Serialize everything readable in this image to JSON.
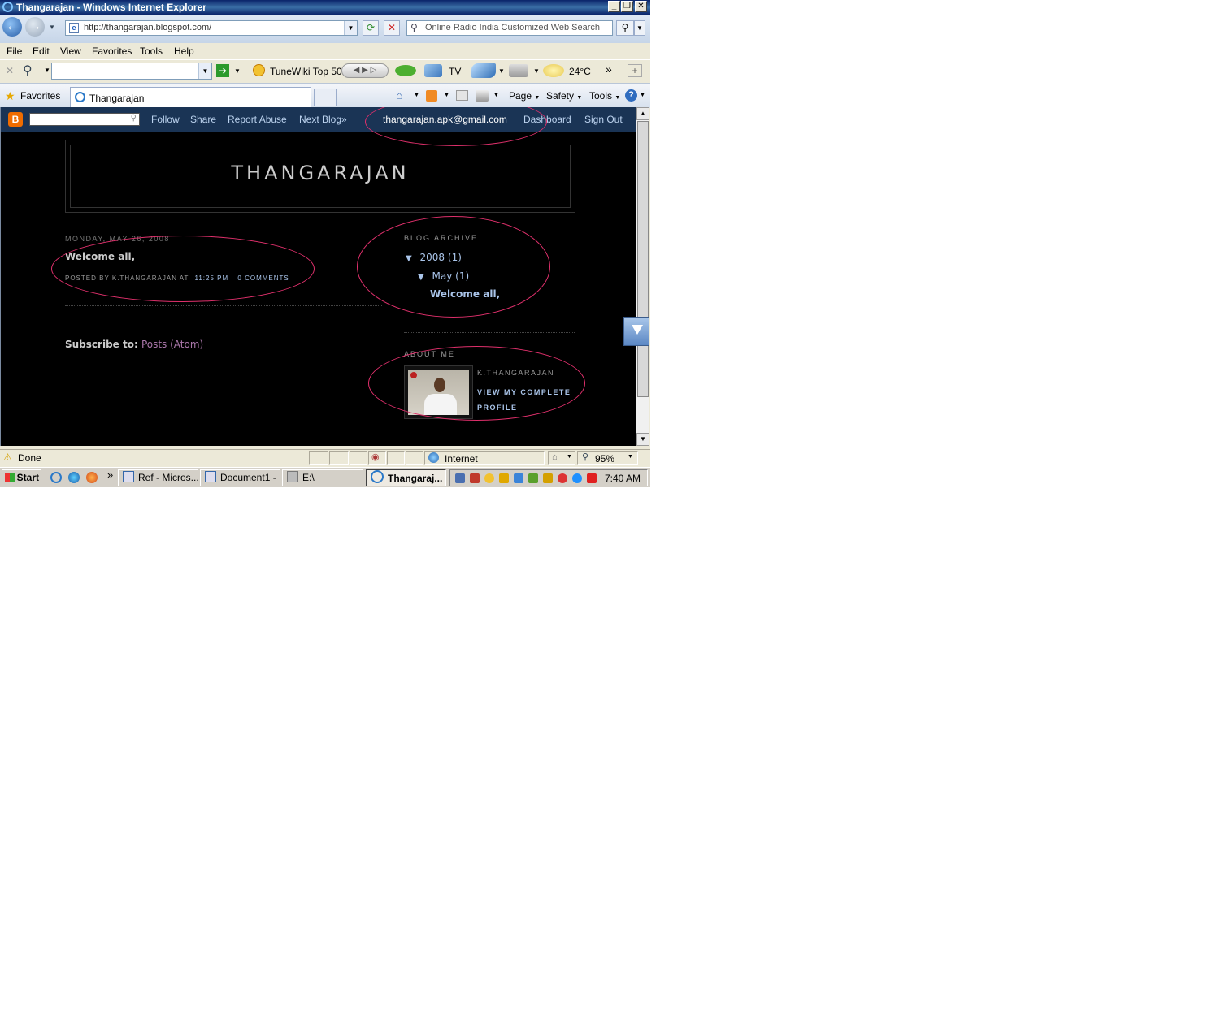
{
  "window": {
    "title": "Thangarajan - Windows Internet Explorer",
    "controls": {
      "minimize": "_",
      "restore": "❐",
      "close": "✕"
    }
  },
  "address_bar": {
    "url": "http://thangarajan.blogspot.com/",
    "search_placeholder": "Online Radio India Customized Web Search"
  },
  "menu": [
    "File",
    "Edit",
    "View",
    "Favorites",
    "Tools",
    "Help"
  ],
  "toolbar": {
    "tunewiki": "TuneWiki Top 50",
    "tv": "TV",
    "temperature": "24°C",
    "more": "»"
  },
  "tabs_row": {
    "favorites": "Favorites",
    "tab_title": "Thangarajan",
    "page": "Page",
    "safety": "Safety",
    "tools": "Tools"
  },
  "blogger_navbar": {
    "links": [
      "Follow",
      "Share",
      "Report Abuse",
      "Next Blog»"
    ],
    "email": "thangarajan.apk@gmail.com",
    "dashboard": "Dashboard",
    "sign_out": "Sign Out"
  },
  "blog": {
    "title": "THANGARAJAN",
    "post": {
      "date": "MONDAY, MAY 26, 2008",
      "title": "Welcome all,",
      "posted_by": "POSTED BY K.THANGARAJAN AT",
      "time": "11:25 PM",
      "comments": "0 COMMENTS"
    },
    "subscribe_label": "Subscribe to:",
    "subscribe_link": "Posts (Atom)",
    "archive": {
      "heading": "BLOG ARCHIVE",
      "year": "2008",
      "year_count": "(1)",
      "month": "May",
      "month_count": "(1)",
      "post": "Welcome all,"
    },
    "about": {
      "heading": "ABOUT ME",
      "name": "K.THANGARAJAN",
      "link_line1": "VIEW MY COMPLETE",
      "link_line2": "PROFILE"
    }
  },
  "status_bar": {
    "status": "Done",
    "zone": "Internet",
    "zoom": "95%"
  },
  "taskbar": {
    "start": "Start",
    "more": "»",
    "buttons": [
      "Ref - Micros...",
      "Document1 - ...",
      "E:\\",
      "Thangaraj..."
    ],
    "clock": "7:40 AM"
  },
  "colors": {
    "blogger_nav": "#1a3455",
    "page_bg": "#000000",
    "link": "#aac5ea",
    "annotation": "#e0306c"
  }
}
